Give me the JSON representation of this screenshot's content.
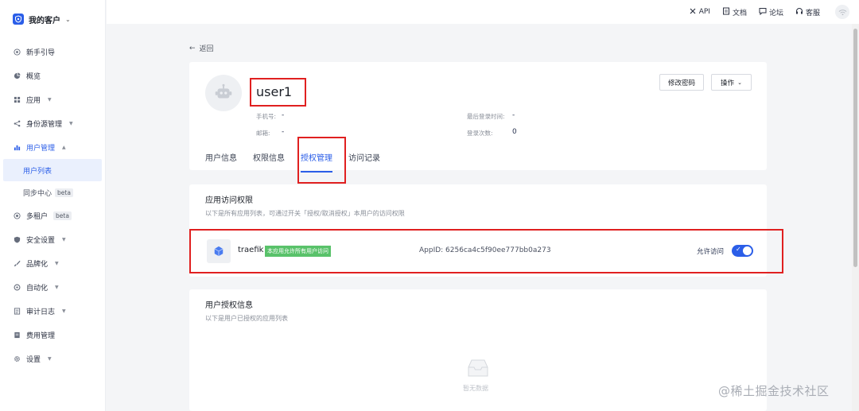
{
  "sidebar": {
    "brand": "我的客户",
    "items": [
      {
        "label": "新手引导",
        "icon": "compass-icon"
      },
      {
        "label": "概览",
        "icon": "pie-chart-icon"
      },
      {
        "label": "应用",
        "icon": "apps-icon"
      },
      {
        "label": "身份源管理",
        "icon": "share-icon"
      },
      {
        "label": "用户管理",
        "icon": "users-icon"
      },
      {
        "label": "多租户",
        "icon": "tenant-icon",
        "badge": "beta"
      },
      {
        "label": "安全设置",
        "icon": "shield-icon"
      },
      {
        "label": "品牌化",
        "icon": "brush-icon"
      },
      {
        "label": "自动化",
        "icon": "automation-icon"
      },
      {
        "label": "审计日志",
        "icon": "log-icon"
      },
      {
        "label": "费用管理",
        "icon": "billing-icon"
      },
      {
        "label": "设置",
        "icon": "gear-icon"
      }
    ],
    "sub_items": [
      {
        "label": "用户列表"
      },
      {
        "label": "同步中心",
        "badge": "beta"
      }
    ]
  },
  "topbar": {
    "api": "API",
    "docs": "文档",
    "forum": "论坛",
    "support": "客服"
  },
  "back": "返回",
  "user": {
    "name": "user1",
    "phone_label": "手机号:",
    "phone_value": "-",
    "email_label": "邮箱:",
    "email_value": "-",
    "last_login_label": "最后登录时间:",
    "last_login_value": "-",
    "login_count_label": "登录次数:",
    "login_count_value": "0"
  },
  "buttons": {
    "change_password": "修改密码",
    "actions": "操作"
  },
  "tabs": [
    "用户信息",
    "权限信息",
    "授权管理",
    "访问记录"
  ],
  "app_access": {
    "title": "应用访问权限",
    "desc": "以下是所有应用列表，可通过开关「授权/取消授权」本用户的访问权限",
    "app": {
      "name": "traefik",
      "tag": "本应用允许所有用户访问",
      "app_id": "AppID: 6256ca4c5f90ee777bb0a273",
      "allow_label": "允许访问",
      "allowed": true
    }
  },
  "user_auth": {
    "title": "用户授权信息",
    "desc": "以下是用户已授权的应用列表",
    "empty": "暂无数据"
  },
  "watermark": "@稀土掘金技术社区",
  "colors": {
    "accent": "#2b5ee8",
    "highlight": "#e02020",
    "tag": "#59c26a"
  }
}
